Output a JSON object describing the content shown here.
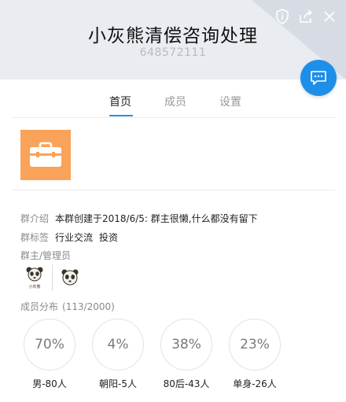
{
  "header": {
    "title": "小灰熊清偿咨询处理",
    "group_id": "648572111"
  },
  "top_icons": [
    "shield-info-icon",
    "share-icon",
    "close-icon"
  ],
  "tabs": [
    {
      "label": "首页",
      "active": true
    },
    {
      "label": "成员",
      "active": false
    },
    {
      "label": "设置",
      "active": false
    }
  ],
  "info": {
    "intro_label": "群介绍",
    "intro_value": "本群创建于2018/6/5:  群主很懒,什么都没有留下",
    "tags_label": "群标签",
    "tags": [
      "行业交流",
      "投资"
    ],
    "admins_label": "群主/管理员",
    "admin_names": [
      "小灰熊"
    ]
  },
  "distribution": {
    "label": "成员分布",
    "count": "(113/2000)",
    "stats": [
      {
        "percent": "70%",
        "caption": "男-80人"
      },
      {
        "percent": "4%",
        "caption": "朝阳-5人"
      },
      {
        "percent": "38%",
        "caption": "80后-43人"
      },
      {
        "percent": "23%",
        "caption": "单身-26人"
      }
    ]
  },
  "colors": {
    "accent": "#1e8fe8",
    "avatar_bg": "#f9a35a",
    "header_bg": "#e9ecf1"
  }
}
